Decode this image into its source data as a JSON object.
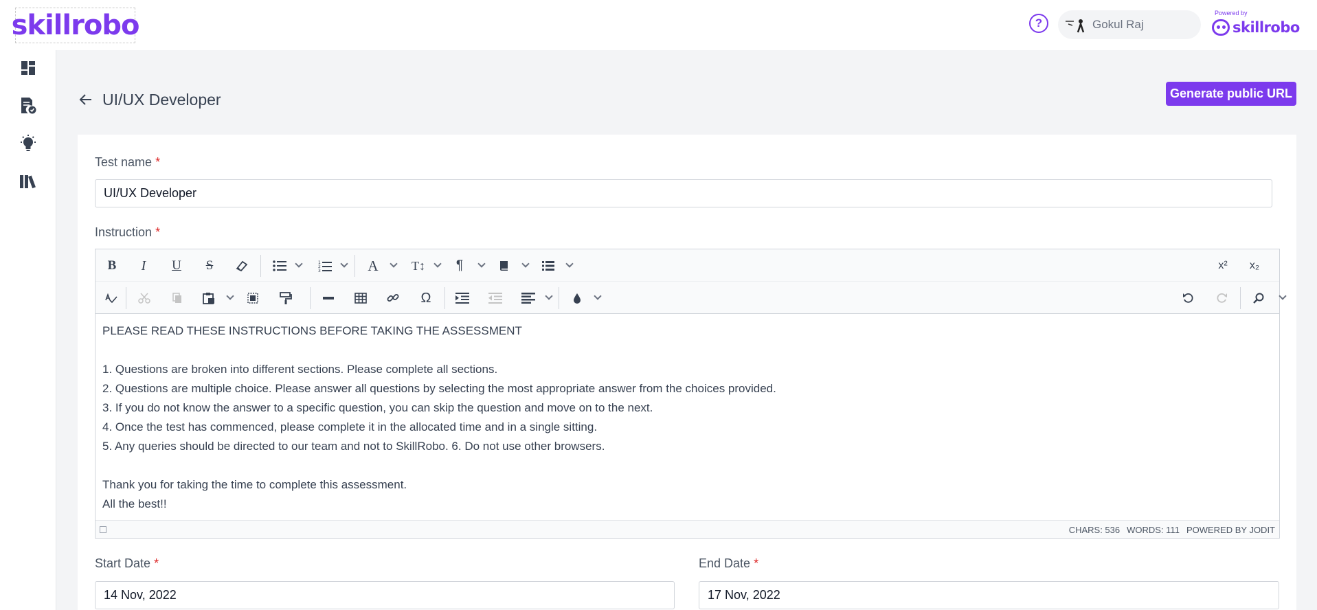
{
  "header": {
    "logo_text": "skillrobo",
    "help_symbol": "?",
    "user_name": "Gokul Raj",
    "powered_by_label": "Powered by",
    "powered_brand": "skillrobo"
  },
  "sidebar": {
    "items": [
      {
        "icon": "dashboard-icon"
      },
      {
        "icon": "test-document-icon"
      },
      {
        "icon": "lightbulb-icon"
      },
      {
        "icon": "library-icon"
      }
    ]
  },
  "page": {
    "title": "UI/UX Developer",
    "generate_button": "Generate public URL"
  },
  "form": {
    "test_name_label": "Test name",
    "test_name_value": "UI/UX Developer",
    "instruction_label": "Instruction",
    "required_mark": "*",
    "start_date_label": "Start Date",
    "start_date_value": "14 Nov, 2022",
    "end_date_label": "End Date",
    "end_date_value": "17 Nov, 2022"
  },
  "editor": {
    "toolbar_row1": [
      "bold",
      "italic",
      "underline",
      "strikethrough",
      "eraser",
      "bulleted-list",
      "numbered-list",
      "font",
      "font-size",
      "paragraph",
      "classes",
      "line-height",
      "superscript",
      "subscript"
    ],
    "toolbar_row2": [
      "spellcheck",
      "cut",
      "copy",
      "paste",
      "select-all",
      "copy-format",
      "horizontal-line",
      "table",
      "link",
      "symbol",
      "indent",
      "outdent",
      "align",
      "brush",
      "undo",
      "redo",
      "search",
      "fullsize",
      "preview"
    ],
    "glyphs": {
      "bold": "B",
      "italic": "I",
      "underline": "U",
      "strike": "S",
      "font": "A",
      "font_size": "T↕",
      "paragraph": "¶",
      "symbol": "Ω",
      "sup": "x²",
      "sub": "x₂"
    },
    "content": [
      "PLEASE READ THESE INSTRUCTIONS BEFORE TAKING THE ASSESSMENT",
      "",
      "1. Questions are broken into different sections. Please complete all sections.",
      "2. Questions are multiple choice. Please answer all questions by selecting the most appropriate answer from the choices provided.",
      "3. If you do not know the answer to a specific question, you can skip the question and move on to the next.",
      "4. Once the test has commenced, please complete it in the allocated time and in a single sitting.",
      "5. Any queries should be directed to our team and not to SkillRobo. 6. Do not use other browsers.",
      "",
      "Thank you for taking the time to complete this assessment.",
      "All the best!!"
    ],
    "status": {
      "chars": "CHARS: 536",
      "words": "WORDS: 111",
      "powered": "POWERED BY JODIT"
    }
  },
  "colors": {
    "accent": "#7c3aed",
    "required": "#dc2626",
    "background": "#f3f4f6"
  }
}
